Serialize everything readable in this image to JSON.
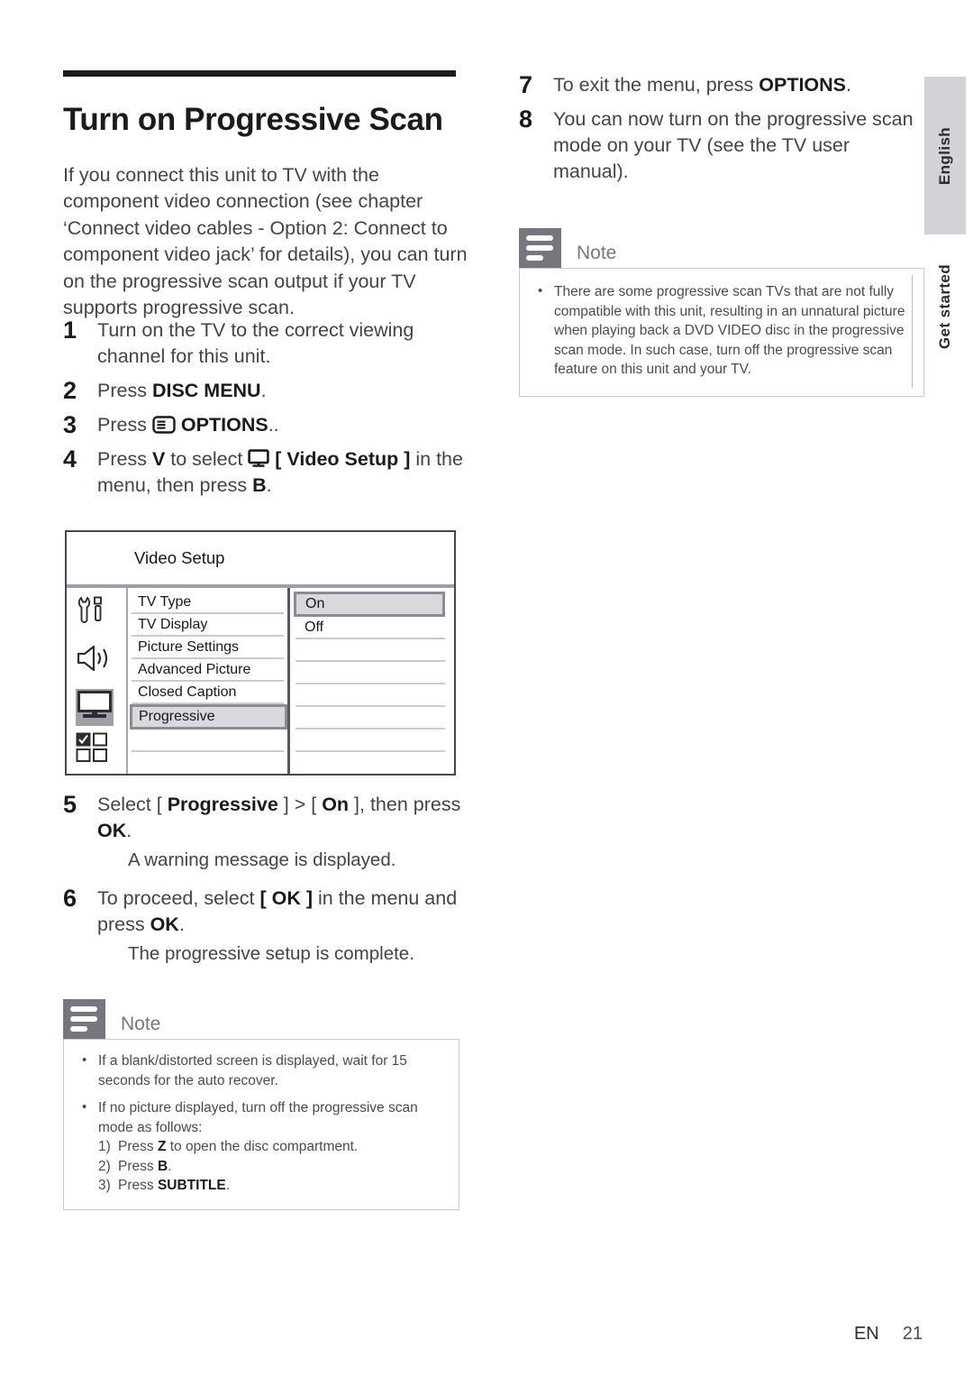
{
  "page_title": "Turn on Progressive Scan",
  "intro": "If you connect this unit to TV with the component video connection (see chapter ‘Connect video cables - Option 2: Connect to component video jack’ for details), you can turn on the progressive scan output if your TV supports progressive scan.",
  "steps_left": [
    {
      "num": "1",
      "text_pre": "Turn on the TV to the correct viewing channel for this unit.",
      "bold": "",
      "text_post": ""
    },
    {
      "num": "2",
      "text_pre": "Press ",
      "bold": "DISC MENU",
      "text_post": "."
    },
    {
      "num": "3",
      "text_pre": "Press ",
      "icon": "options-menu-icon",
      "bold": "OPTIONS",
      "text_post": ".."
    },
    {
      "num": "4",
      "text_pre": "Press ",
      "key1": "V",
      "mid": " to select ",
      "icon": "tv-monitor-icon",
      "bold": "[ Video Setup ]",
      "text_post": " in the menu, then press ",
      "key2": "B",
      "tail": "."
    },
    {
      "num": "5",
      "text_pre": "Select [ ",
      "bold": "Progressive",
      "mid": " ] > [ ",
      "bold2": "On",
      "text_post": " ], then press ",
      "bold3": "OK",
      "tail": ".",
      "sub": "A warning message is displayed."
    },
    {
      "num": "6",
      "text_pre": "To proceed, select ",
      "bold": "[ OK ]",
      "mid": " in the menu and press ",
      "bold2": "OK",
      "tail": ".",
      "sub": "The progressive setup is complete."
    }
  ],
  "steps_right": [
    {
      "num": "7",
      "text_pre": "To exit the menu, press ",
      "bold": "OPTIONS",
      "text_post": "."
    },
    {
      "num": "8",
      "text_pre": "You can now turn on the progressive scan mode on your TV (see the TV user manual).",
      "bold": "",
      "text_post": ""
    }
  ],
  "osd": {
    "title": "Video Setup",
    "icons": [
      "tools-setup-icon",
      "speaker-audio-icon",
      "tv-video-icon",
      "checkbox-grid-icon"
    ],
    "selected_icon_index": 2,
    "items": [
      "TV Type",
      "TV Display",
      "Picture Settings",
      "Advanced Picture",
      "Closed Caption",
      "Progressive"
    ],
    "selected_item": "Progressive",
    "values": [
      "On",
      "Off"
    ],
    "selected_value": "On"
  },
  "note_right": {
    "label": "Note",
    "bullets": [
      "There are some progressive scan TVs that are not fully compatible with this unit, resulting in an unnatural picture when playing back a DVD VIDEO disc in the progressive scan mode. In such case, turn off the progressive scan feature on this unit and your TV."
    ]
  },
  "note_left": {
    "label": "Note",
    "bullets": [
      "If a blank/distorted screen is displayed, wait for 15 seconds for the auto recover.",
      "If no picture displayed, turn off the progressive scan mode as follows:"
    ],
    "sub_items": [
      {
        "num": "1)",
        "pre": "Press ",
        "key": "Z",
        "post": " to open the disc compartment."
      },
      {
        "num": "2)",
        "pre": "Press ",
        "key": "B",
        "post": "."
      },
      {
        "num": "3)",
        "pre": "Press ",
        "key": "SUBTITLE",
        "post": "."
      }
    ]
  },
  "side_tabs": {
    "language": "English",
    "section": "Get started"
  },
  "footer": {
    "lang_code": "EN",
    "page_number": "21"
  }
}
